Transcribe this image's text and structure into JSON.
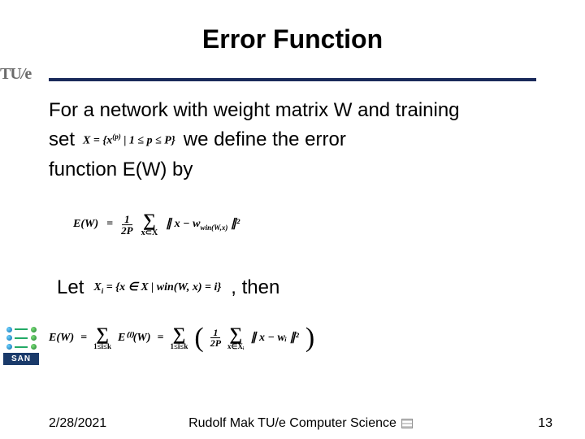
{
  "slide": {
    "title": "Error Function",
    "body": {
      "line1": "For a network with weight matrix  W  and training",
      "line2_a": "set",
      "set_def": "X = {x⁽ᵖ⁾ | 1 ≤ p ≤ P}",
      "line2_b": "we define the error",
      "line3": "function  E(W)  by"
    },
    "eq1": {
      "lhs": "E(W)",
      "eq": "=",
      "frac_num": "1",
      "frac_den": "2P",
      "sum_sub": "x⊂X",
      "norm": "∥ x − w",
      "norm_sub": "win(W,x)",
      "norm_end": " ∥²"
    },
    "let": {
      "let": "Let",
      "xi_def": "Xᵢ = {x ∈ X | win(W, x) = i}",
      "then": ", then"
    },
    "eq2": {
      "lhs": "E(W)",
      "eq": "=",
      "sum1_sub": "1≤i≤k",
      "ei": "E⁽ⁱ⁾(W)",
      "eq2": "=",
      "sum2_sub": "1≤i≤k",
      "frac_num": "1",
      "frac_den": "2P",
      "sum3_sub": "x∈Xᵢ",
      "norm": "∥ x − wᵢ ∥²"
    },
    "logos": {
      "tue": "TU/e",
      "san": "SAN"
    },
    "footer": {
      "date": "2/28/2021",
      "center": "Rudolf Mak TU/e Computer Science",
      "page": "13"
    }
  }
}
